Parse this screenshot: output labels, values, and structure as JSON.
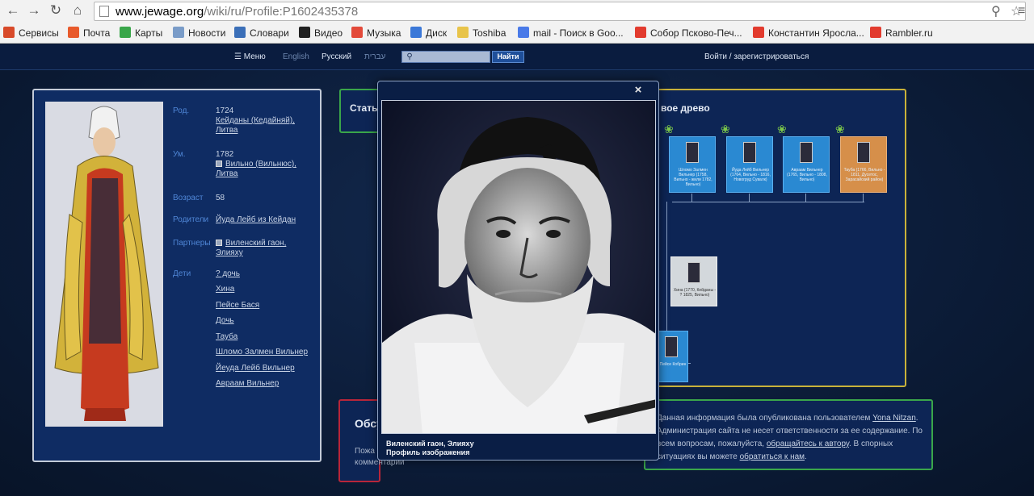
{
  "browser": {
    "url_host": "www.jewage.org",
    "url_path": "/wiki/ru/Profile:P1602435378",
    "bookmarks": [
      {
        "label": "Сервисы",
        "icon": "apps-grid-icon",
        "color": "#d84a2a"
      },
      {
        "label": "Почта",
        "icon": "mail-favicon",
        "color": "#e85a2c"
      },
      {
        "label": "Карты",
        "icon": "maps-favicon",
        "color": "#3aa64a"
      },
      {
        "label": "Новости",
        "icon": "page-favicon",
        "color": "#7a9cc8"
      },
      {
        "label": "Словари",
        "icon": "dictionary-favicon",
        "color": "#3b6fb8"
      },
      {
        "label": "Видео",
        "icon": "video-favicon",
        "color": "#222222"
      },
      {
        "label": "Музыка",
        "icon": "music-favicon",
        "color": "#e34a3a"
      },
      {
        "label": "Диск",
        "icon": "disk-favicon",
        "color": "#3b78d8"
      },
      {
        "label": "Toshiba",
        "icon": "folder-icon",
        "color": "#e8c44a"
      },
      {
        "label": "mail - Поиск в Goo...",
        "icon": "google-favicon",
        "color": "#4a7ae8"
      },
      {
        "label": "Собор Псково-Печ...",
        "icon": "yandex-favicon",
        "color": "#e23b2e"
      },
      {
        "label": "Константин Яросла...",
        "icon": "yandex-favicon",
        "color": "#e23b2e"
      },
      {
        "label": "Rambler.ru",
        "icon": "yandex-favicon",
        "color": "#e23b2e"
      }
    ]
  },
  "site": {
    "menu_label": "Меню",
    "lang_en": "English",
    "lang_ru": "Русский",
    "lang_he": "עברית",
    "search_button": "Найти",
    "login_label": "Войти / зарегистрироваться"
  },
  "profile": {
    "born_label": "Род.",
    "born_year": "1724",
    "born_place": "Кейданы (Кедайняй), Литва",
    "died_label": "Ум.",
    "died_year": "1782",
    "died_place": "Вильно (Вильнюс), Литва",
    "age_label": "Возраст",
    "age_value": "58",
    "parents_label": "Родители",
    "parents_value": "Йуда Лейб из Кейдан",
    "partners_label": "Партнеры",
    "partners_value": "Виленский гаон, Элияху",
    "children_label": "Дети",
    "children": [
      "? дочь",
      "Хина",
      "Пейсе Бася",
      "Дочь",
      "Тауба",
      "Шломо Залмен Вильнер",
      "Йеуда Лейб Вильнер",
      "Авраам Вильнер"
    ]
  },
  "article_panel": {
    "title": "Стать"
  },
  "tree_panel": {
    "title": "вое древо",
    "nodes": [
      {
        "caption": "Шломо Залмен Вильнер (1758, Вильно - жили 1782, Вильно)"
      },
      {
        "caption": "Йуда Лейб Вильнер (1764, Вильно - 1816, Новогруд Сувалк)"
      },
      {
        "caption": "Авраам Вильнер (1765, Вильно - 1808, Вильно)"
      },
      {
        "caption": "Тауба (1766, Вильно - 1811, Дусетос, Зарасайский район)"
      },
      {
        "caption": "Хина (1770, Кейданы - ? 1825, Вильно)"
      },
      {
        "caption": "Пейсе Кобрин"
      }
    ]
  },
  "comments_panel": {
    "title": "Обсу",
    "subtitle_1": "Пожа",
    "subtitle_2": "комментарии"
  },
  "notice": {
    "t1": "Данная информация была опубликована пользователем ",
    "author": "Yona Nitzan",
    "t2": ". Администрация сайта не несет ответственности за ее содержание. По всем вопросам, пожалуйста, ",
    "link1": "обращайтесь к автору",
    "t3": ". В спорных ситуациях вы можете ",
    "link2": "обратиться к нам",
    "t4": "."
  },
  "modal": {
    "close_label": "×",
    "caption_name": "Виленский гаон, Элияху",
    "caption_sub": "Профиль изображения"
  }
}
